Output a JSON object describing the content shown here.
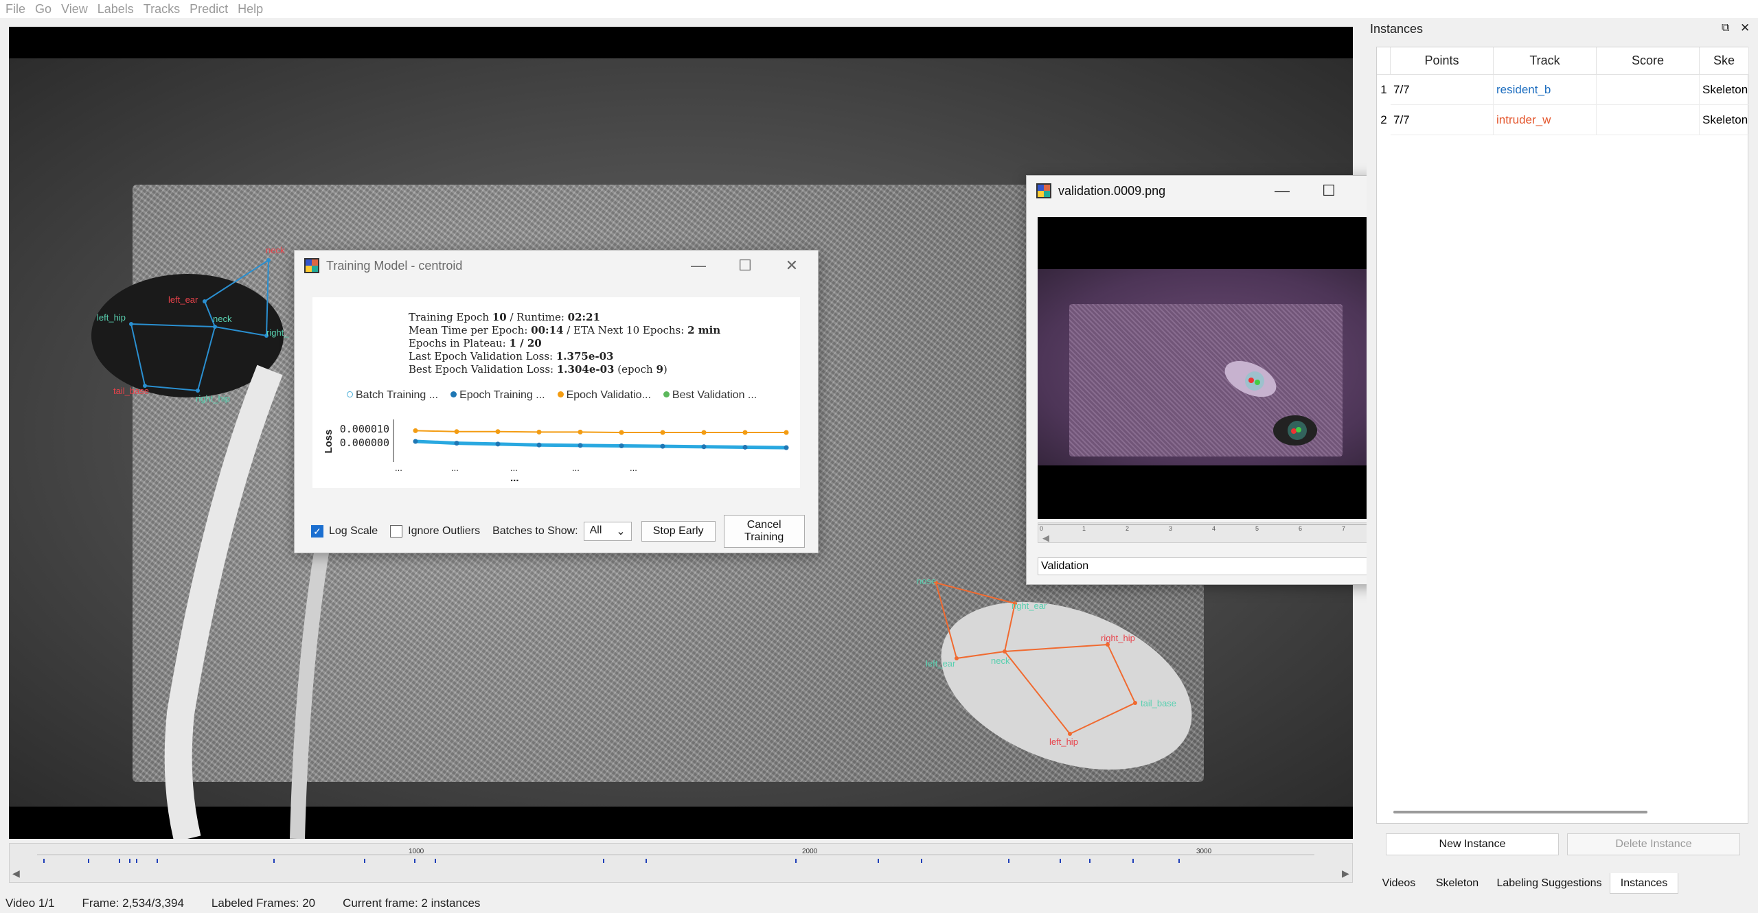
{
  "menu": [
    "File",
    "Go",
    "View",
    "Labels",
    "Tracks",
    "Predict",
    "Help"
  ],
  "skeleton_labels": {
    "mouse1": [
      "neck",
      "left_ear",
      "left_hip",
      "neck",
      "right_",
      "tail_base",
      "right_hip"
    ],
    "mouse2": [
      "nose",
      "right_ear",
      "right_hip",
      "left_ear",
      "neck",
      "tail_base",
      "left_hip"
    ]
  },
  "training": {
    "title": "Training Model - centroid",
    "epoch_label": "Training Epoch ",
    "epoch_value": "10",
    "runtime_label": " / Runtime: ",
    "runtime_value": "02:21",
    "mean_time_label": "Mean Time per Epoch: ",
    "mean_time_value": "00:14",
    "eta_label": " / ETA Next 10 Epochs: ",
    "eta_value": "2 min",
    "plateau_label": "Epochs in Plateau: ",
    "plateau_value": "1 / 20",
    "last_loss_label": "Last Epoch Validation Loss: ",
    "last_loss_value": "1.375e-03",
    "best_loss_label": "Best Epoch Validation Loss: ",
    "best_loss_value": "1.304e-03",
    "best_epoch_label": " (epoch ",
    "best_epoch_value": "9",
    "best_epoch_close": ")",
    "legend": [
      "Batch Training ...",
      "Epoch Training ...",
      "Epoch Validatio...",
      "Best Validation ..."
    ],
    "y_axis_label": "Loss",
    "y_ticks": [
      "0.000010",
      "0.000000"
    ],
    "x_ticks": [
      "...",
      "...",
      "...",
      "...",
      "..."
    ],
    "x_label": "...",
    "log_scale_label": "Log Scale",
    "ignore_outliers_label": "Ignore Outliers",
    "batches_label": "Batches to Show:",
    "batches_value": "All",
    "stop_button": "Stop Early",
    "cancel_button": "Cancel Training"
  },
  "chart_data": {
    "type": "line",
    "series": [
      {
        "name": "Epoch Training ...",
        "values": [
          1.0,
          0.98,
          0.97,
          0.96,
          0.955,
          0.95,
          0.945,
          0.94,
          0.935,
          0.93
        ]
      },
      {
        "name": "Epoch Validatio...",
        "values": [
          1.12,
          1.11,
          1.11,
          1.105,
          1.105,
          1.1,
          1.1,
          1.1,
          1.1,
          1.1
        ]
      }
    ],
    "ylabel": "Loss"
  },
  "validation": {
    "title": "validation.0009.png",
    "ruler_ticks": [
      "0",
      "1",
      "2",
      "3",
      "4",
      "5",
      "6",
      "7"
    ],
    "combo_value": "Validation"
  },
  "instances": {
    "title": "Instances",
    "columns": [
      "Points",
      "Track",
      "Score",
      "Ske"
    ],
    "rows": [
      {
        "num": "1",
        "points": "7/7",
        "track": "resident_b",
        "track_color": "#1f6fc0",
        "score": "",
        "skeleton": "Skeleton"
      },
      {
        "num": "2",
        "points": "7/7",
        "track": "intruder_w",
        "track_color": "#e4572e",
        "score": "",
        "skeleton": "Skeleton"
      }
    ],
    "new_button": "New Instance",
    "delete_button": "Delete Instance",
    "tabs": [
      "Videos",
      "Skeleton",
      "Labeling Suggestions",
      "Instances"
    ]
  },
  "timeline": {
    "ticks": [
      "1000",
      "2000",
      "3000"
    ]
  },
  "status": {
    "video": "Video 1/1",
    "frame": "Frame: 2,534/3,394",
    "labeled": "Labeled Frames: 20",
    "current": "Current frame: 2 instances"
  }
}
